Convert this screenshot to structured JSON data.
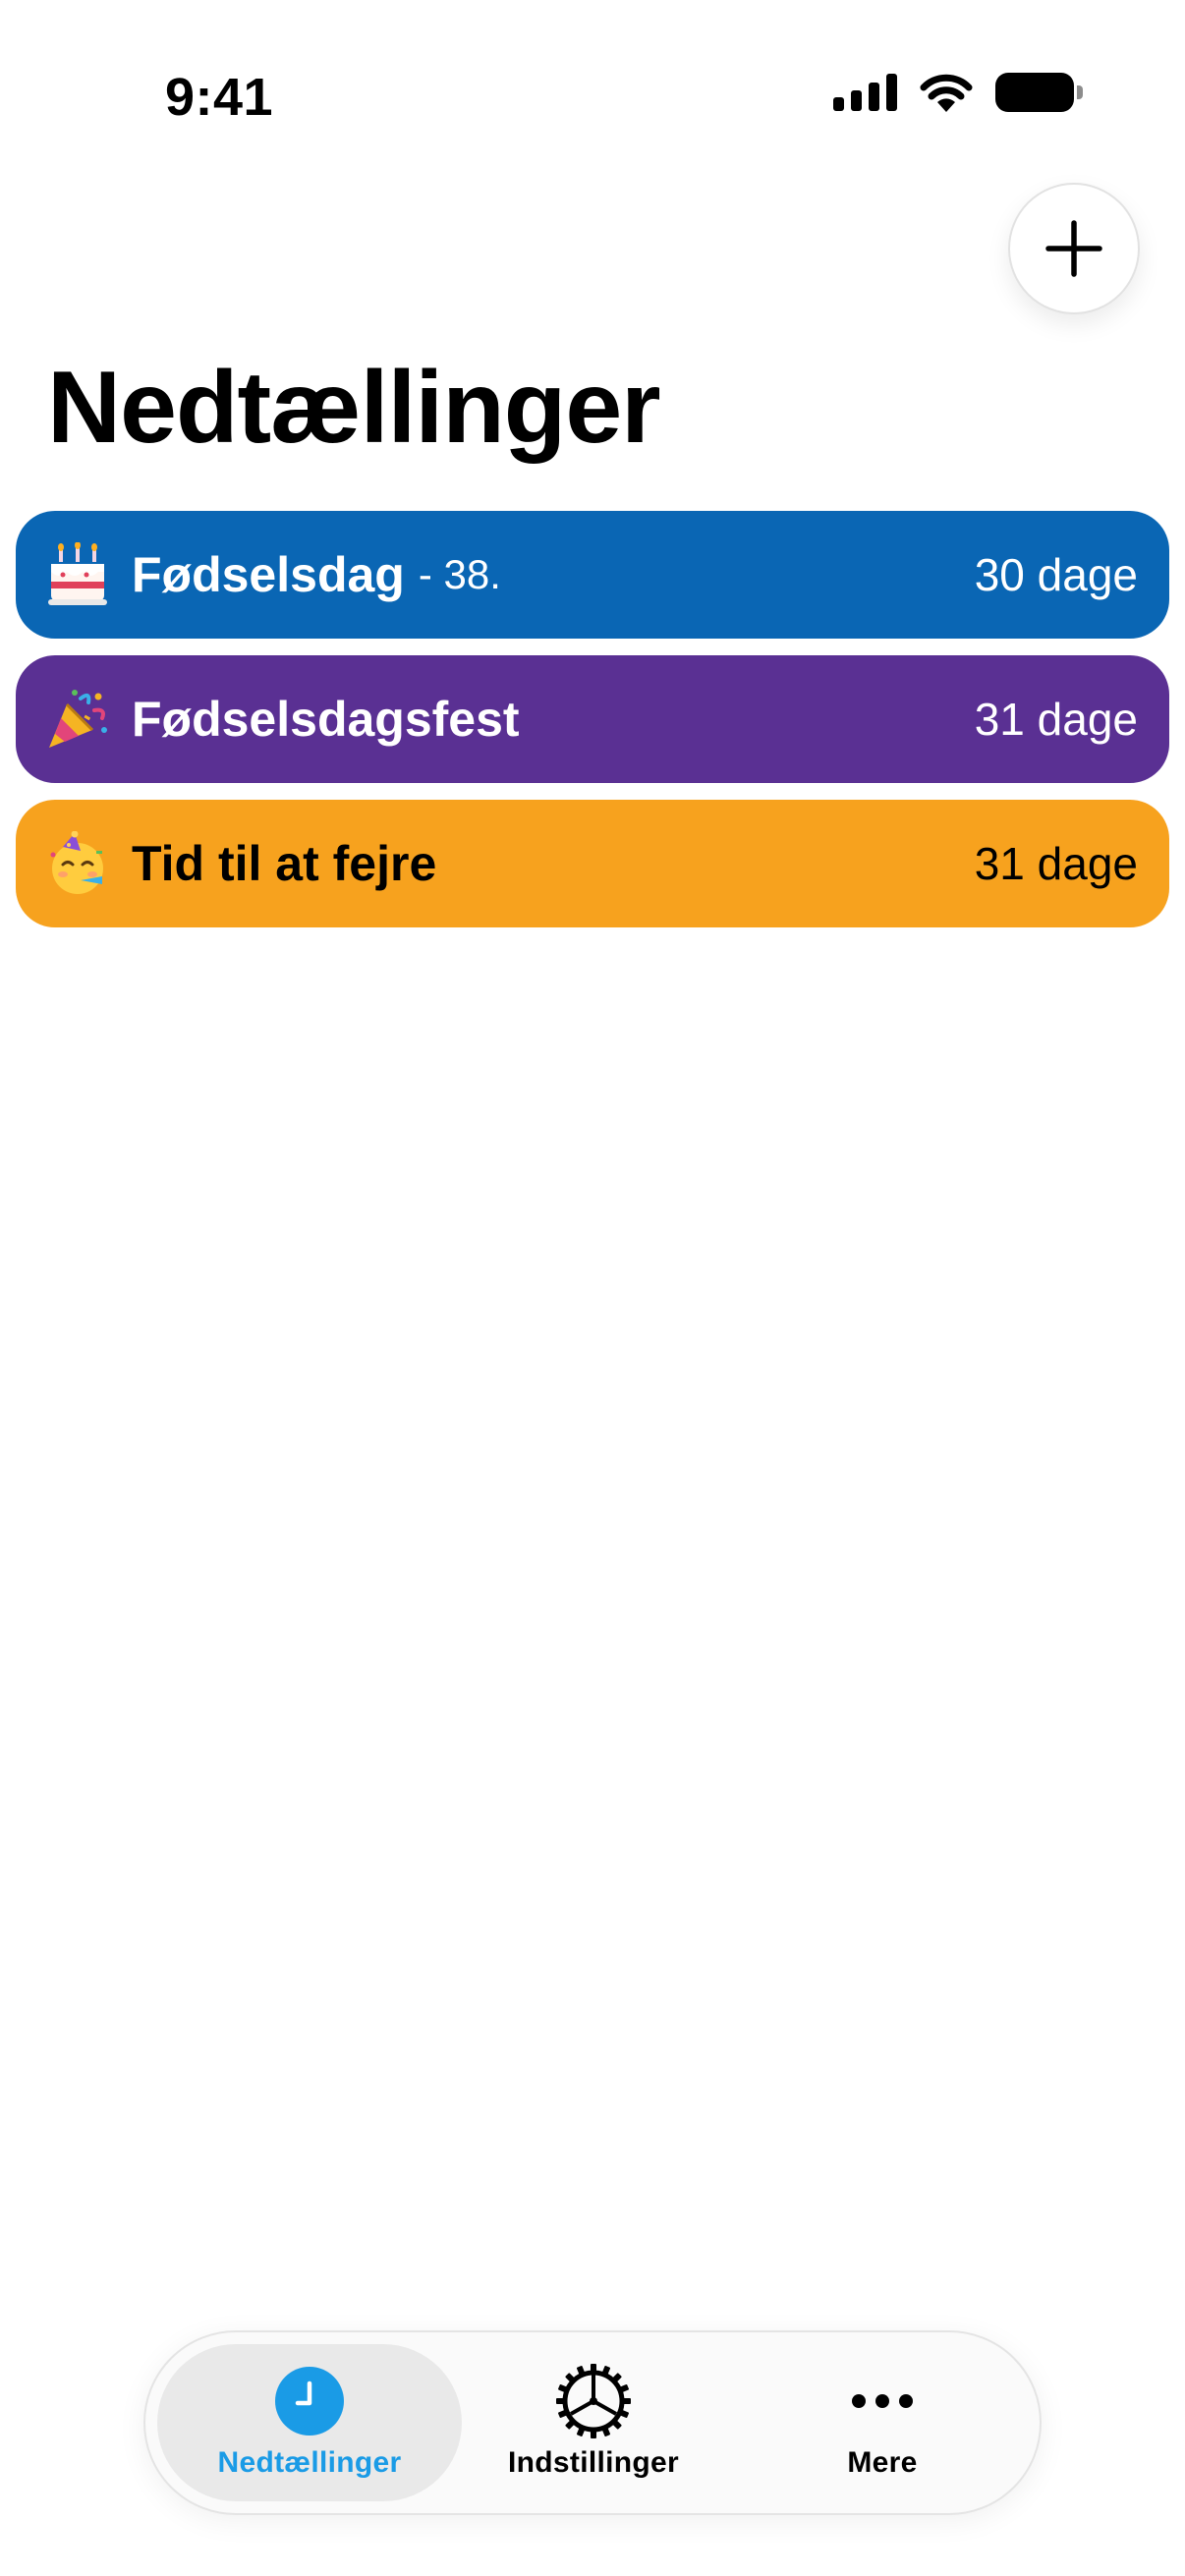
{
  "status_bar": {
    "time": "9:41",
    "icons": [
      "cellular-signal-icon",
      "wifi-icon",
      "battery-icon"
    ]
  },
  "header": {
    "add_button_icon": "plus-icon",
    "title": "Nedtællinger"
  },
  "countdowns": [
    {
      "emoji": "birthday-cake-icon",
      "name": "Fødselsdag",
      "suffix": "- 38.",
      "days": "30 dage",
      "color": "#0A66B4",
      "text_color": "#FFFFFF"
    },
    {
      "emoji": "party-popper-icon",
      "name": "Fødselsdagsfest",
      "suffix": "",
      "days": "31 dage",
      "color": "#5A3093",
      "text_color": "#FFFFFF"
    },
    {
      "emoji": "partying-face-icon",
      "name": "Tid til at fejre",
      "suffix": "",
      "days": "31 dage",
      "color": "#F7A21E",
      "text_color": "#000000"
    }
  ],
  "tab_bar": {
    "tabs": [
      {
        "label": "Nedtællinger",
        "icon": "clock-icon",
        "active": true
      },
      {
        "label": "Indstillinger",
        "icon": "gear-icon",
        "active": false
      },
      {
        "label": "Mere",
        "icon": "ellipsis-icon",
        "active": false
      }
    ],
    "active_color": "#1A9BE6"
  }
}
